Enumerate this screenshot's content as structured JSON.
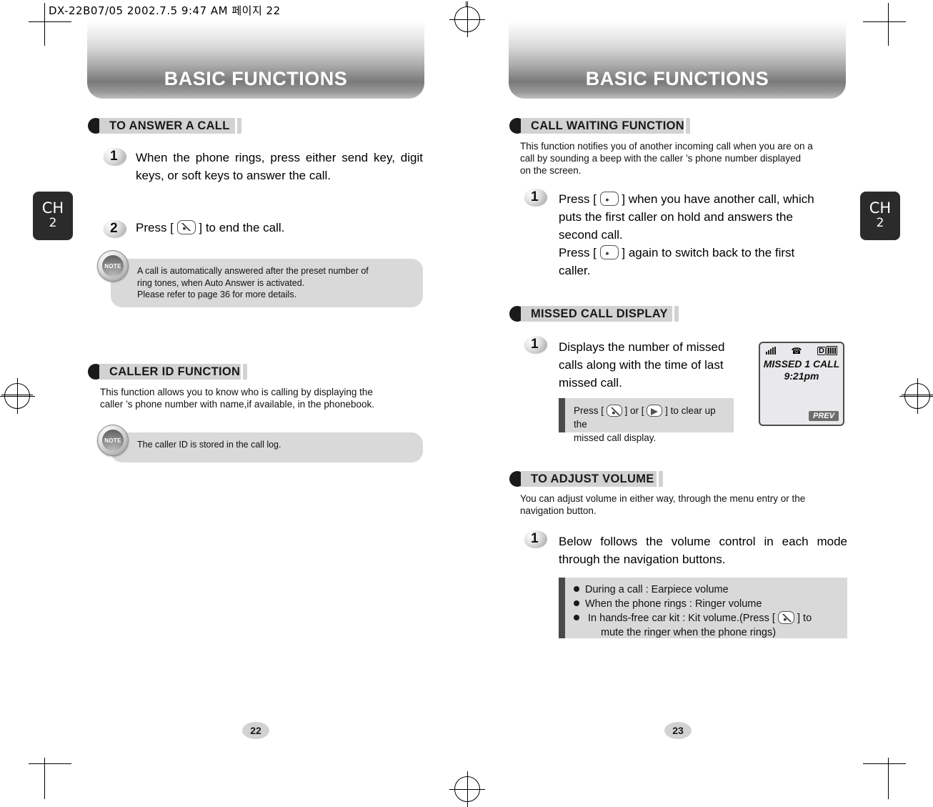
{
  "print_slug": "DX-22B07/05  2002.7.5 9:47 AM  페이지 22",
  "left_page": {
    "banner_title": "BASIC FUNCTIONS",
    "chapter_tab": {
      "line1": "CH",
      "line2": "2"
    },
    "page_number": "22",
    "sections": [
      {
        "heading": "TO ANSWER A CALL",
        "steps": [
          {
            "num": "1",
            "text": "When the phone rings, press either send key, digit keys, or soft keys to answer the call."
          },
          {
            "num": "2",
            "text_before": "Press [",
            "icon": "end-key-icon",
            "text_after": "] to end the call."
          }
        ],
        "note": {
          "badge": "NOTE",
          "lines": [
            "A call is automatically answered after the preset number of",
            "ring tones, when Auto Answer is activated.",
            "Please refer to page 36 for more details."
          ]
        }
      },
      {
        "heading": "CALLER ID FUNCTION",
        "intro": [
          "This function allows you to know who is calling by displaying the",
          "caller ’s phone number with name,if available, in the phonebook."
        ],
        "note": {
          "badge": "NOTE",
          "lines": [
            "The caller ID is stored in the call log."
          ]
        }
      }
    ]
  },
  "right_page": {
    "banner_title": "BASIC FUNCTIONS",
    "chapter_tab": {
      "line1": "CH",
      "line2": "2"
    },
    "page_number": "23",
    "sections": [
      {
        "heading": "CALL WAITING FUNCTION",
        "intro": [
          "This function notifies you of another incoming call when you are on a",
          "call by sounding a beep with the caller ’s phone  number displayed",
          "on the screen."
        ],
        "step_num": "1",
        "step_lines": [
          "Press [ @ ] when you have another call, which",
          "puts the first caller on hold and answers the",
          "second call.",
          "Press [ @ ] again to switch back to the first",
          "caller."
        ]
      },
      {
        "heading": "MISSED CALL DISPLAY",
        "step_num": "1",
        "step_text": "Displays the number of missed calls along with the time of last missed call.",
        "callout_lines": [
          "Press [ @ ]  or [ @ ] to clear up the",
          "missed call display."
        ],
        "lcd": {
          "line1": "MISSED 1 CALL",
          "line2": "9:21pm",
          "softkey": "PREV",
          "battery_label": "D"
        }
      },
      {
        "heading": "TO ADJUST VOLUME",
        "intro": [
          "You can adjust volume in either way, through the menu entry or the",
          "navigation button."
        ],
        "step_num": "1",
        "step_text": "Below follows the volume control in each mode through the navigation buttons.",
        "bullets": [
          "During a call : Earpiece volume",
          "When the phone rings : Ringer volume",
          "In hands-free car kit : Kit volume.(Press [ @ ] to",
          "mute the ringer when the phone rings)"
        ]
      }
    ]
  }
}
